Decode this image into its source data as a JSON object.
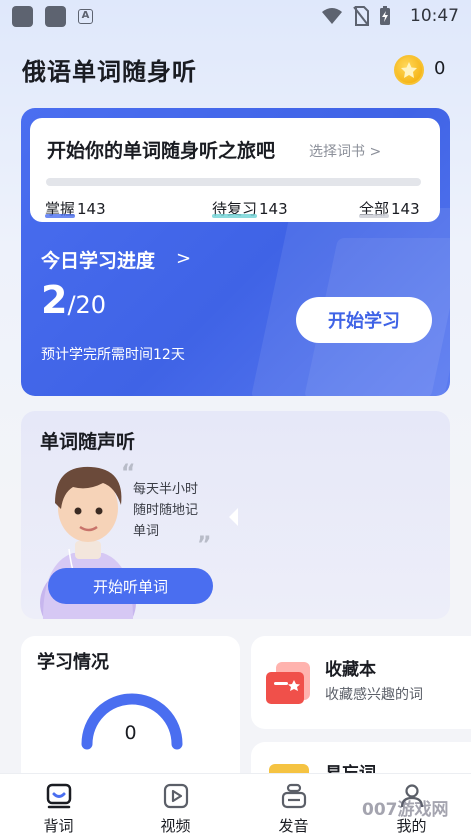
{
  "status_bar": {
    "time": "10:47"
  },
  "header": {
    "title": "俄语单词随身听",
    "coin_count": "0"
  },
  "book_card": {
    "title": "开始你的单词随身听之旅吧",
    "choose_label": "选择词书 >",
    "stats": [
      {
        "label": "掌握",
        "value": "143"
      },
      {
        "label": "待复习",
        "value": "143"
      },
      {
        "label": "全部",
        "value": "143"
      }
    ]
  },
  "progress": {
    "title": "今日学习进度",
    "arrow": ">",
    "current": "2",
    "total": "/20",
    "estimate": "预计学完所需时间12天",
    "start_label": "开始学习"
  },
  "listen": {
    "title": "单词随声听",
    "bubble_lines": [
      "每天半小时",
      "随时随地记",
      "单词"
    ],
    "button_label": "开始听单词"
  },
  "study": {
    "title": "学习情况",
    "value": "0"
  },
  "favorites": {
    "title": "收藏本",
    "subtitle": "收藏感兴趣的词"
  },
  "forget": {
    "title": "易忘词"
  },
  "tabs": [
    {
      "label": "背词",
      "icon": "word-book-icon"
    },
    {
      "label": "视频",
      "icon": "video-icon"
    },
    {
      "label": "发音",
      "icon": "pronunciation-icon"
    },
    {
      "label": "我的",
      "icon": "profile-icon"
    }
  ],
  "watermark": "007游戏网",
  "colors": {
    "accent": "#4a6ef0",
    "coin": "#f2a900",
    "fav_red": "#f0504a"
  }
}
